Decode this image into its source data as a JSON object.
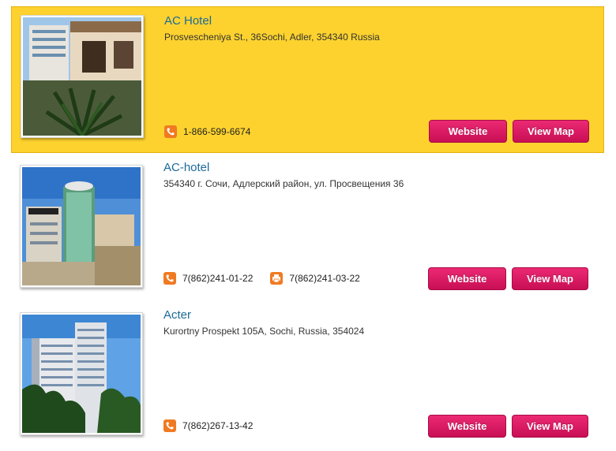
{
  "listings": [
    {
      "name": "AC Hotel",
      "address": "Prosvescheniya St., 36Sochi, Adler, 354340 Russia",
      "phones": [
        {
          "type": "phone",
          "number": "1-866-599-6674"
        }
      ],
      "website_label": "Website",
      "map_label": "View Map"
    },
    {
      "name": "AC-hotel",
      "address": "354340 г. Сочи, Адлерский район, ул. Просвещения 36",
      "phones": [
        {
          "type": "phone",
          "number": "7(862)241-01-22"
        },
        {
          "type": "fax",
          "number": "7(862)241-03-22"
        }
      ],
      "website_label": "Website",
      "map_label": "View Map"
    },
    {
      "name": "Acter",
      "address": "Kurortny Prospekt 105A, Sochi, Russia, 354024",
      "phones": [
        {
          "type": "phone",
          "number": "7(862)267-13-42"
        }
      ],
      "website_label": "Website",
      "map_label": "View Map"
    }
  ],
  "colors": {
    "highlight_bg": "#fdd22e",
    "title_link": "#1b6a9a",
    "button": "#d4145a",
    "phone_icon": "#f07a22"
  },
  "icons": {
    "phone": "phone-icon",
    "fax": "fax-icon"
  }
}
